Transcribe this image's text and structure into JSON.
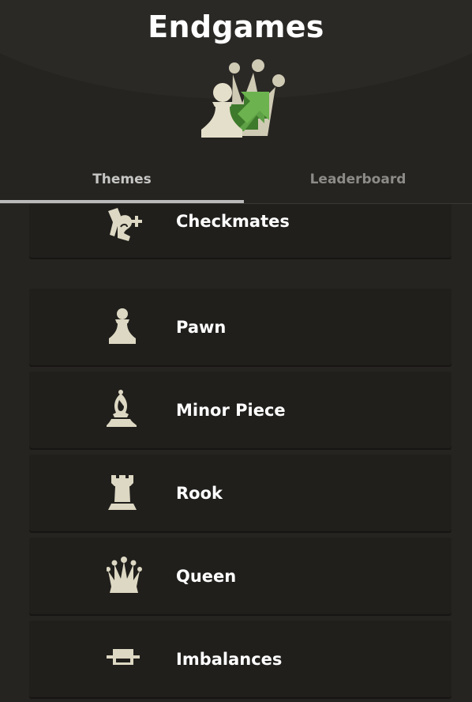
{
  "page": {
    "title": "Endgames"
  },
  "tabs": [
    {
      "label": "Themes",
      "active": true
    },
    {
      "label": "Leaderboard",
      "active": false
    }
  ],
  "themes": [
    {
      "label": "Checkmates",
      "icon": "checkmate-king-icon"
    },
    {
      "label": "Pawn",
      "icon": "pawn-icon"
    },
    {
      "label": "Minor Piece",
      "icon": "bishop-icon"
    },
    {
      "label": "Rook",
      "icon": "rook-icon"
    },
    {
      "label": "Queen",
      "icon": "queen-icon"
    },
    {
      "label": "Imbalances",
      "icon": "imbalance-scale-icon"
    }
  ],
  "colors": {
    "background": "#262421",
    "row_background": "#201f1c",
    "piece": "#ddd8c3",
    "accent_green": "#5ea045",
    "tab_active": "#c6c6c4",
    "tab_inactive": "#8d8b88"
  }
}
